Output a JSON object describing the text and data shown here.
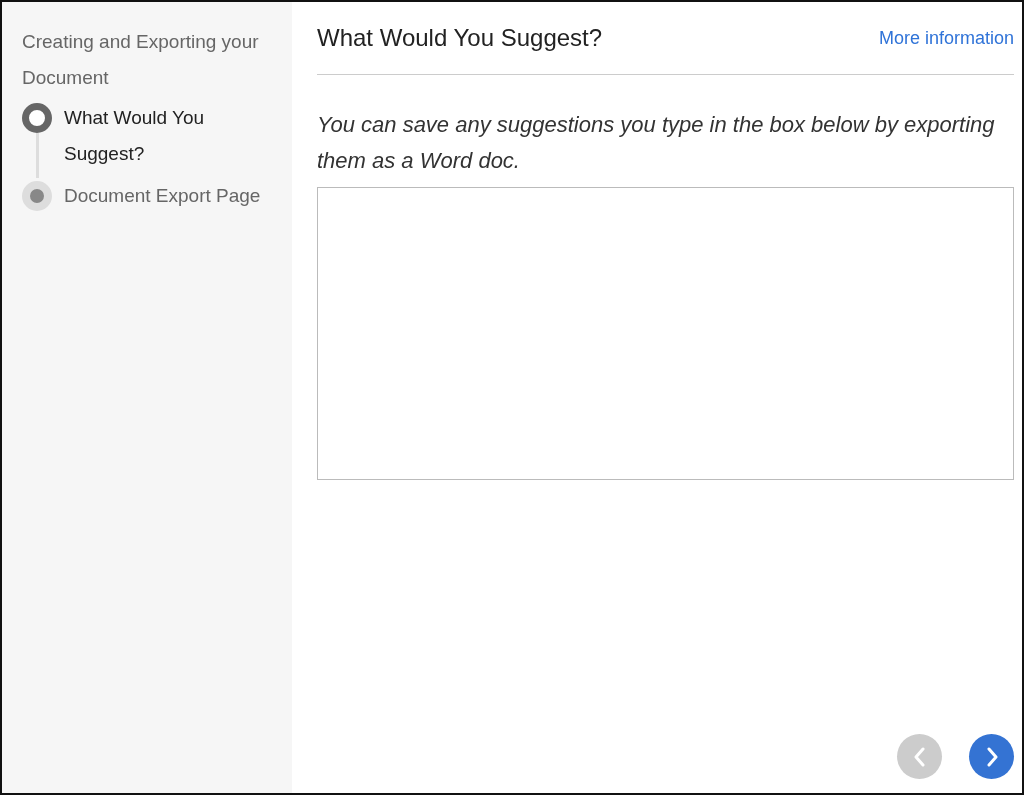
{
  "sidebar": {
    "title": "Creating and Exporting your Document",
    "steps": [
      {
        "label": "What Would You Suggest?",
        "selected": true
      },
      {
        "label": "Document Export Page",
        "selected": false
      }
    ]
  },
  "header": {
    "title": "What Would You Suggest?",
    "link": "More information"
  },
  "instructions": "You can save any suggestions you type in the box below by exporting them as a Word doc.",
  "nav": {
    "previous": {
      "disabled": true
    },
    "next": {
      "disabled": false
    }
  }
}
